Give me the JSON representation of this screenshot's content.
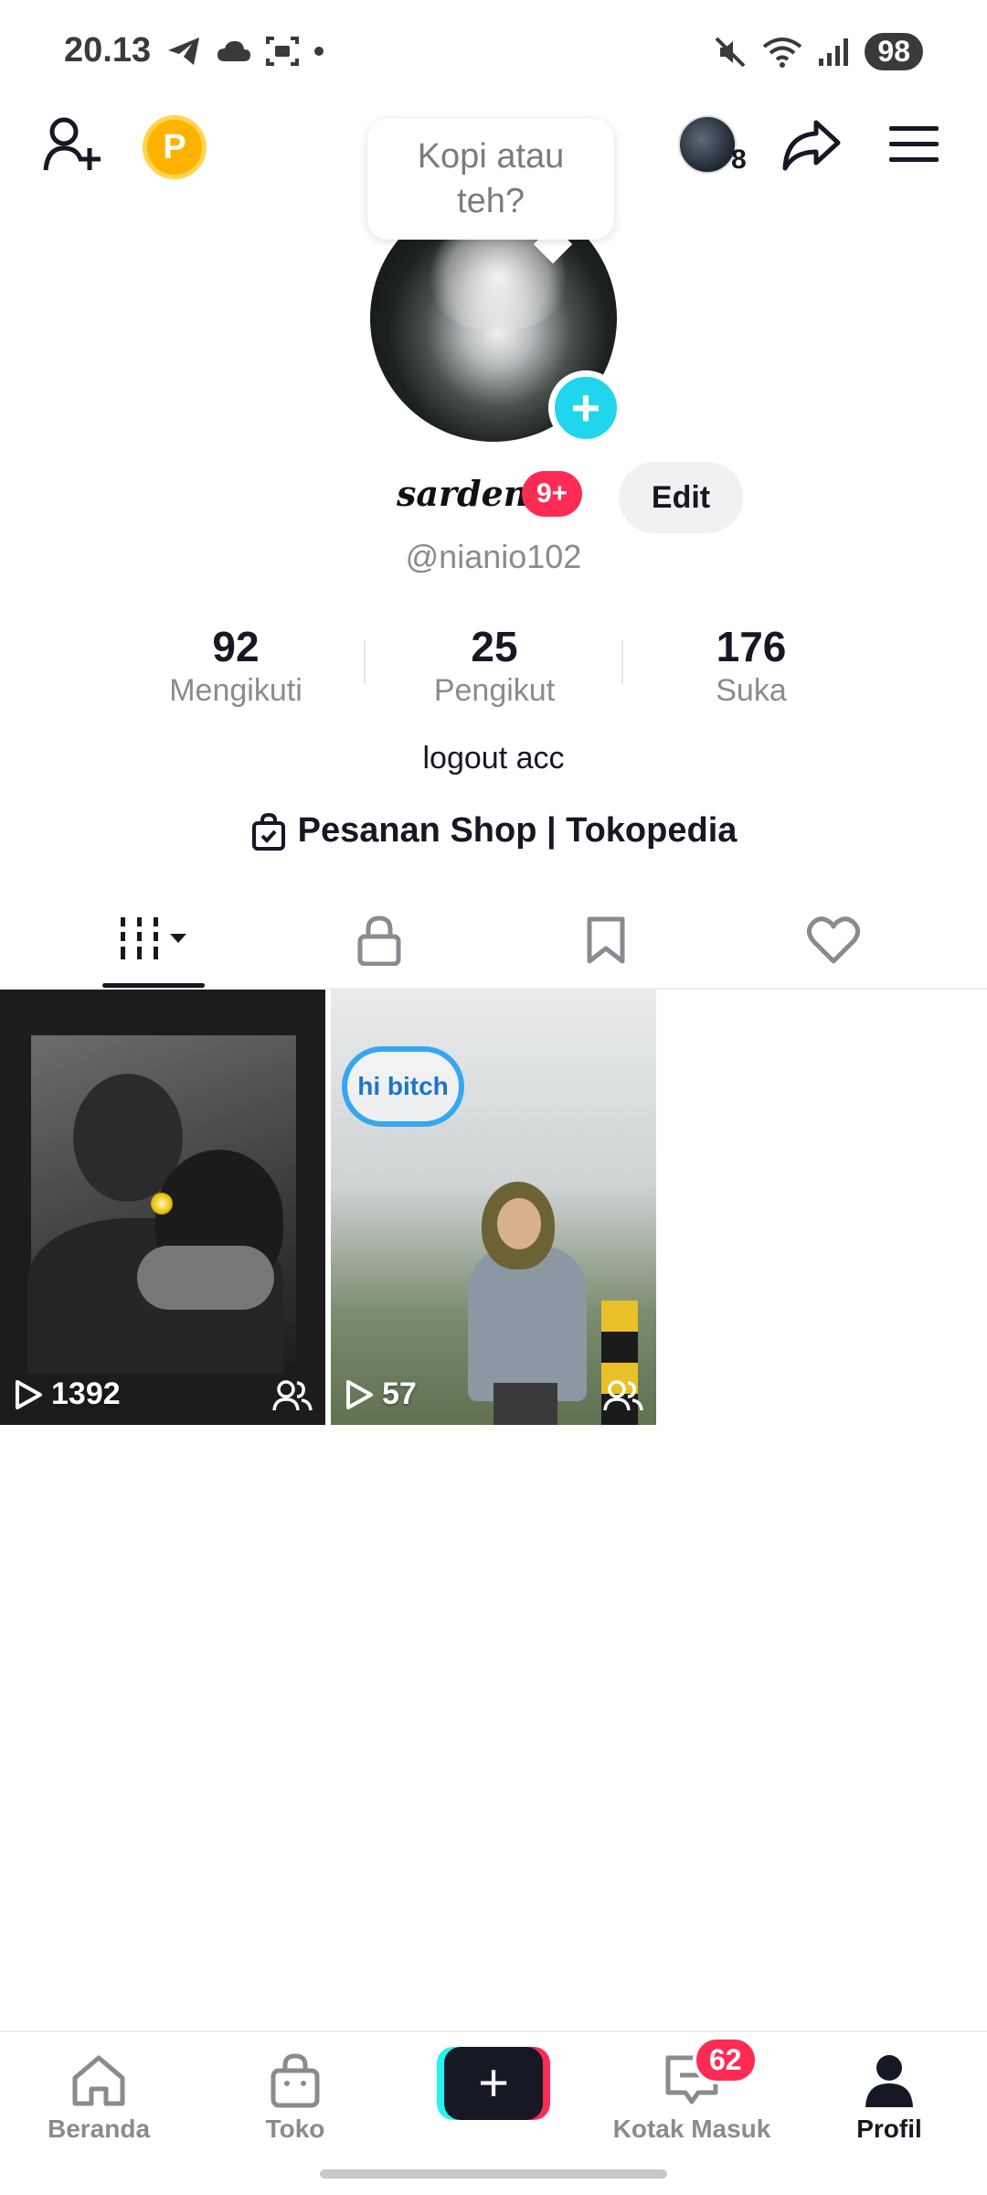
{
  "status_bar": {
    "time": "20.13",
    "battery": "98",
    "icons_left": [
      "telegram-icon",
      "cloud-icon",
      "screenshot-icon",
      "dot-icon"
    ],
    "icons_right": [
      "mute-icon",
      "wifi-icon",
      "signal-icon"
    ]
  },
  "top_bar": {
    "mini_count": "8",
    "coin_letter": "P"
  },
  "profile": {
    "bubble_text": "Kopi atau teh?",
    "display_name": "sarden",
    "notification_badge": "9+",
    "edit_label": "Edit",
    "username": "@nianio102",
    "bio": "logout acc",
    "shop_link": "Pesanan Shop | Tokopedia"
  },
  "stats": [
    {
      "value": "92",
      "label": "Mengikuti"
    },
    {
      "value": "25",
      "label": "Pengikut"
    },
    {
      "value": "176",
      "label": "Suka"
    }
  ],
  "tabs": [
    "videos-tab",
    "private-tab",
    "saved-tab",
    "liked-tab"
  ],
  "videos": [
    {
      "views": "1392",
      "audience": "friends"
    },
    {
      "views": "57",
      "audience": "friends",
      "sticker": "hi bitch"
    }
  ],
  "bottom_nav": [
    {
      "label": "Beranda",
      "icon": "home-icon"
    },
    {
      "label": "Toko",
      "icon": "shop-bag-icon"
    },
    {
      "label": "",
      "icon": "plus-icon"
    },
    {
      "label": "Kotak Masuk",
      "icon": "inbox-icon",
      "badge": "62"
    },
    {
      "label": "Profil",
      "icon": "profile-icon"
    }
  ],
  "colors": {
    "accent_pink": "#fe2c55",
    "accent_cyan": "#20d5ec",
    "text_primary": "#161823",
    "text_secondary": "#8a8b91"
  }
}
